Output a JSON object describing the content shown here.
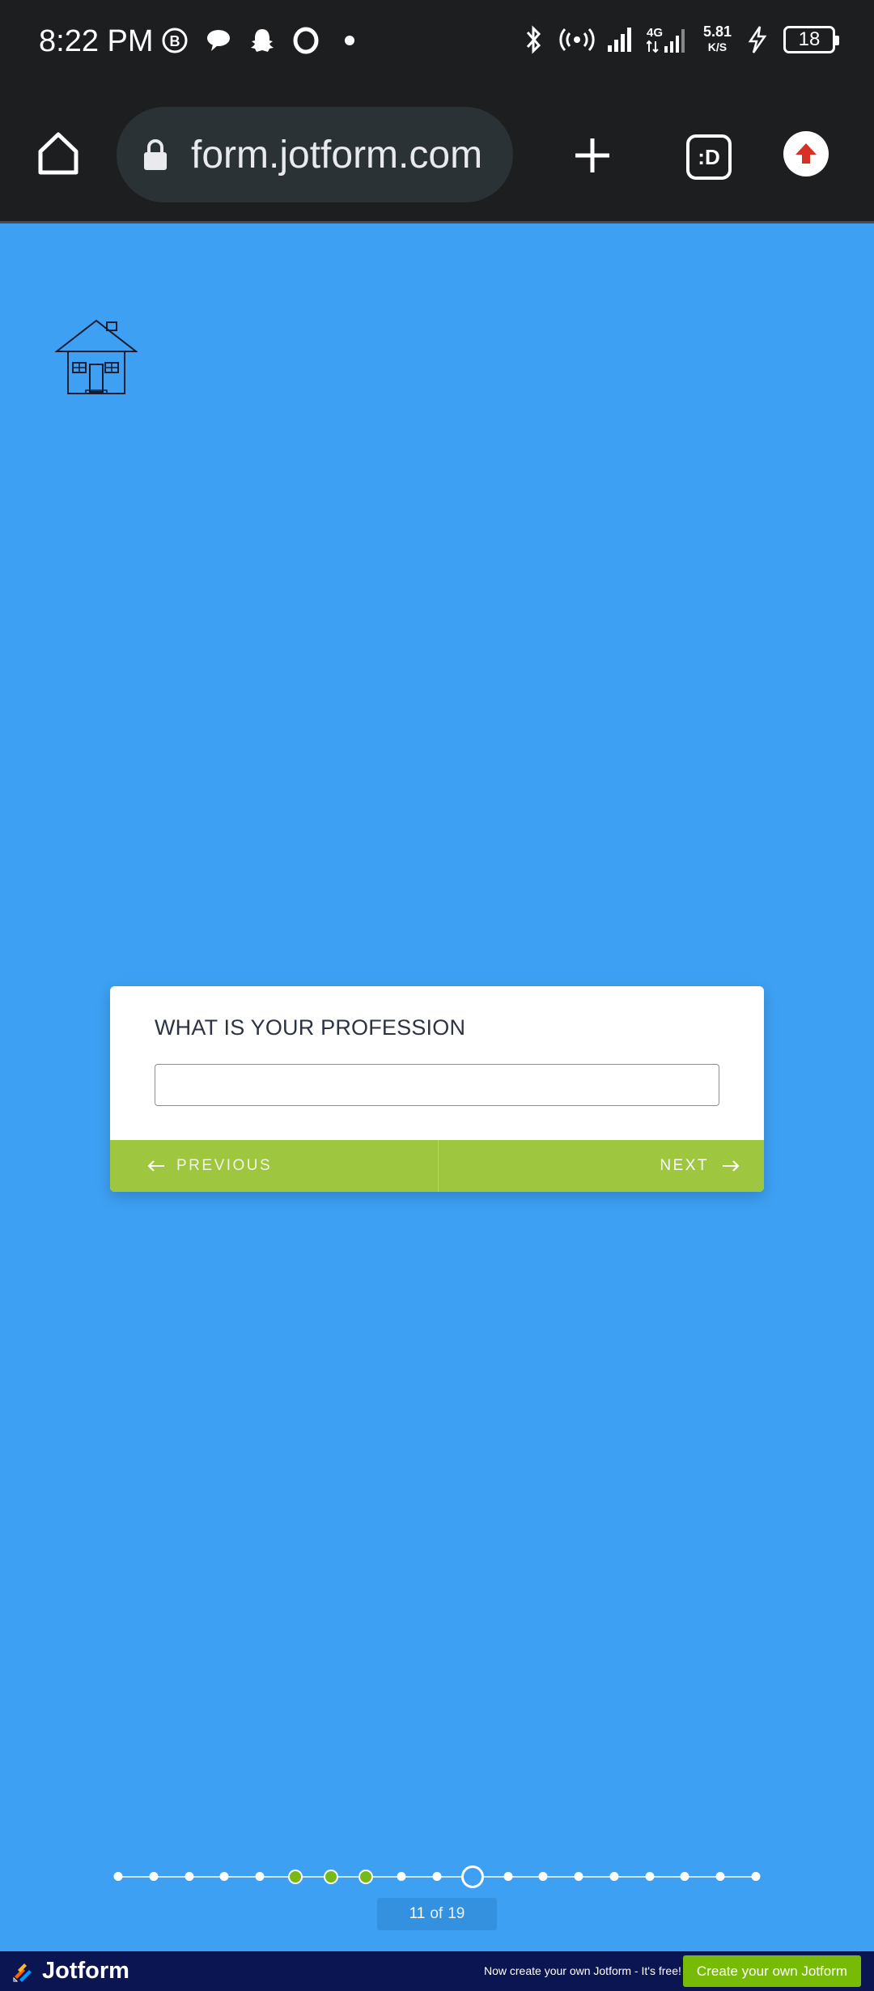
{
  "status_bar": {
    "time": "8:22 PM",
    "network_type": "4G",
    "net_speed_value": "5.81",
    "net_speed_unit": "K/S",
    "battery": "18",
    "left_icons": [
      "b-badge-icon",
      "chat-bubble-icon",
      "snapchat-ghost-icon",
      "opera-icon",
      "dot-icon"
    ],
    "right_icons": [
      "bluetooth-icon",
      "hotspot-icon",
      "signal-icon",
      "4g-signal-icon",
      "charging-icon"
    ]
  },
  "browser": {
    "url": "form.jotform.com",
    "tabs_label": ":D",
    "icons": [
      "home-icon",
      "lock-icon",
      "plus-icon",
      "tabs-icon",
      "upload-icon"
    ]
  },
  "form": {
    "question": "WHAT IS YOUR PROFESSION",
    "answer_value": "",
    "previous_label": "PREVIOUS",
    "next_label": "NEXT"
  },
  "progress": {
    "current": "11",
    "of_label": "of",
    "total": "19",
    "completed_steps": [
      6,
      7,
      8
    ]
  },
  "footer": {
    "brand": "Jotform",
    "promo_text": "Now create your own Jotform - It's free!",
    "cta_label": "Create your own Jotform"
  },
  "colors": {
    "page_background": "#3da0f3",
    "nav_green": "#9ec63e",
    "footer_navy": "#0a1551",
    "cta_green": "#78bb07"
  }
}
